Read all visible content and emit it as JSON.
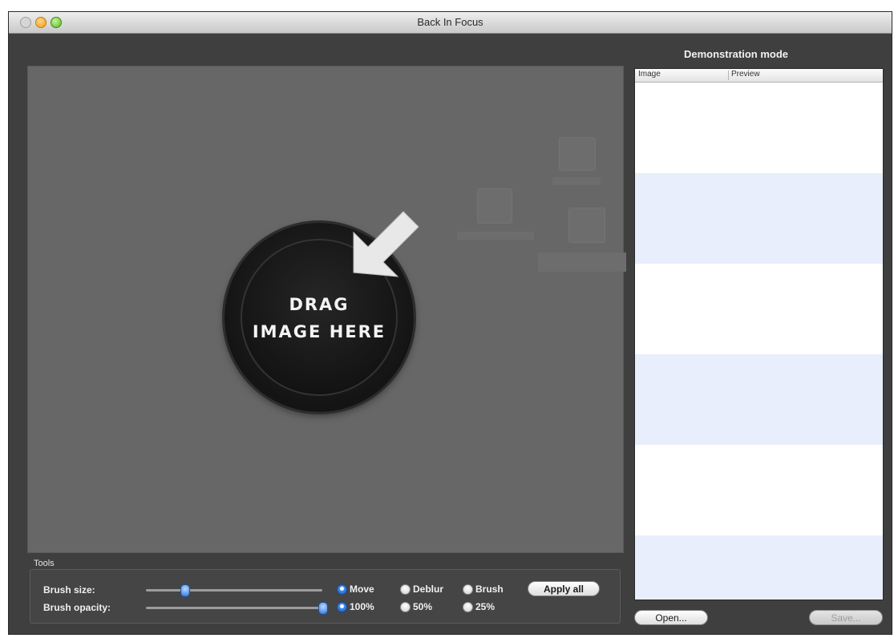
{
  "window": {
    "title": "Back In Focus"
  },
  "drop_zone": {
    "line1": "DRAG",
    "line2": "IMAGE HERE"
  },
  "tools": {
    "label": "Tools",
    "brush_size_label": "Brush size:",
    "brush_opacity_label": "Brush opacity:",
    "brush_size_value": 0.22,
    "brush_opacity_value": 1.0,
    "mode_options": [
      {
        "label": "Move",
        "selected": true
      },
      {
        "label": "Deblur",
        "selected": false
      },
      {
        "label": "Brush",
        "selected": false
      }
    ],
    "opacity_options": [
      {
        "label": "100%",
        "selected": true
      },
      {
        "label": "50%",
        "selected": false
      },
      {
        "label": "25%",
        "selected": false
      }
    ],
    "apply_all_label": "Apply all"
  },
  "sidebar": {
    "mode_text": "Demonstration mode",
    "columns": [
      "Image",
      "Preview"
    ],
    "open_label": "Open...",
    "save_label": "Save..."
  },
  "colors": {
    "accent": "#2a6fd8",
    "alt_row": "#e8eefb"
  }
}
